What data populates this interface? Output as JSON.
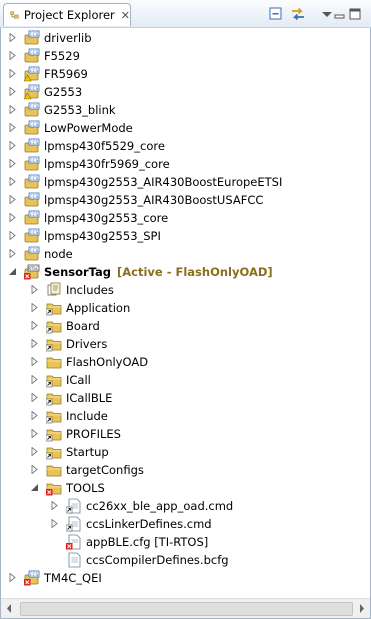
{
  "tab": {
    "title": "Project Explorer",
    "close": "✕",
    "icon": "project-explorer-icon"
  },
  "toolbar": {
    "collapse_icon": "collapse-all-icon",
    "link_icon": "link-with-editor-icon"
  },
  "tree": [
    {
      "label": "driverlib",
      "expanded": false,
      "icon": "ccs-project"
    },
    {
      "label": "F5529",
      "expanded": false,
      "icon": "ccs-project"
    },
    {
      "label": "FR5969",
      "expanded": false,
      "icon": "ccs-project-warning"
    },
    {
      "label": "G2553",
      "expanded": false,
      "icon": "ccs-project-warning"
    },
    {
      "label": "G2553_blink",
      "expanded": false,
      "icon": "ccs-project"
    },
    {
      "label": "LowPowerMode",
      "expanded": false,
      "icon": "ccs-project"
    },
    {
      "label": "lpmsp430f5529_core",
      "expanded": false,
      "icon": "ccs-project"
    },
    {
      "label": "lpmsp430fr5969_core",
      "expanded": false,
      "icon": "ccs-project"
    },
    {
      "label": "lpmsp430g2553_AIR430BoostEuropeETSI",
      "expanded": false,
      "icon": "ccs-project"
    },
    {
      "label": "lpmsp430g2553_AIR430BoostUSAFCC",
      "expanded": false,
      "icon": "ccs-project"
    },
    {
      "label": "lpmsp430g2553_core",
      "expanded": false,
      "icon": "ccs-project"
    },
    {
      "label": "lpmsp430g2553_SPI",
      "expanded": false,
      "icon": "ccs-project"
    },
    {
      "label": "node",
      "expanded": false,
      "icon": "ccs-project"
    },
    {
      "label": "SensorTag",
      "decoration": "[Active - FlashOnlyOAD]",
      "expanded": true,
      "icon": "rtsc-project"
    },
    {
      "label": "Includes",
      "expanded": false,
      "icon": "includes"
    },
    {
      "label": "Application",
      "expanded": false,
      "icon": "folder-link"
    },
    {
      "label": "Board",
      "expanded": false,
      "icon": "folder-link"
    },
    {
      "label": "Drivers",
      "expanded": false,
      "icon": "folder-link"
    },
    {
      "label": "FlashOnlyOAD",
      "expanded": false,
      "icon": "folder"
    },
    {
      "label": "ICall",
      "expanded": false,
      "icon": "folder-link"
    },
    {
      "label": "ICallBLE",
      "expanded": false,
      "icon": "folder-link"
    },
    {
      "label": "Include",
      "expanded": false,
      "icon": "folder-link"
    },
    {
      "label": "PROFILES",
      "expanded": false,
      "icon": "folder-link"
    },
    {
      "label": "Startup",
      "expanded": false,
      "icon": "folder-link"
    },
    {
      "label": "targetConfigs",
      "expanded": false,
      "icon": "folder"
    },
    {
      "label": "TOOLS",
      "expanded": true,
      "icon": "folder-error"
    },
    {
      "label": "cc26xx_ble_app_oad.cmd",
      "expanded": false,
      "icon": "file-link"
    },
    {
      "label": "ccsLinkerDefines.cmd",
      "expanded": false,
      "icon": "file-link"
    },
    {
      "label": "appBLE.cfg [TI-RTOS]",
      "expanded": null,
      "icon": "cfg-error"
    },
    {
      "label": "ccsCompilerDefines.bcfg",
      "expanded": null,
      "icon": "file"
    },
    {
      "label": "TM4C_QEI",
      "expanded": false,
      "icon": "ccs-project-error"
    }
  ],
  "scrollbar": {
    "left_icon": "scroll-left-icon",
    "right_icon": "scroll-right-icon"
  }
}
